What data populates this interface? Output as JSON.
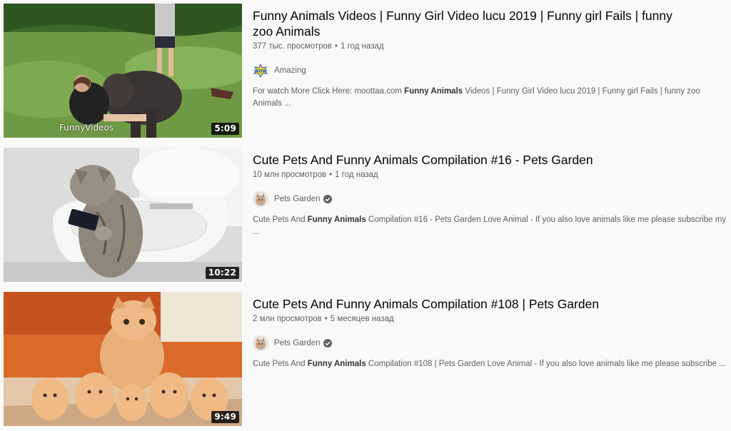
{
  "results": [
    {
      "title": "Funny Animals Videos | Funny Girl Video lucu 2019 | Funny girl Fails | funny zoo Animals",
      "views": "377 тыс. просмотров",
      "age": "1 год назад",
      "channel": "Amazing",
      "verified": false,
      "duration": "5:09",
      "watermark": "FunnyVideos",
      "desc_parts": [
        "For watch More Click Here: moottaa.com ",
        "Funny Animals",
        " Videos | Funny Girl Video lucu 2019 | Funny girl Fails | funny zoo Animals ..."
      ],
      "thumb_icon": "girl-elephant-thumbnail"
    },
    {
      "title": "Cute Pets And Funny Animals Compilation #16 - Pets Garden",
      "views": "10 млн просмотров",
      "age": "1 год назад",
      "channel": "Pets Garden",
      "verified": true,
      "duration": "10:22",
      "desc_parts": [
        "Cute Pets And ",
        "Funny Animals",
        " Compilation #16 - Pets Garden Love Animal - If you also love animals like me please subscribe my ..."
      ],
      "thumb_icon": "cat-on-toilet-thumbnail"
    },
    {
      "title": "Cute Pets And Funny Animals Compilation #108 | Pets Garden",
      "views": "2 млн просмотров",
      "age": "5 месяцев назад",
      "channel": "Pets Garden",
      "verified": true,
      "duration": "9:49",
      "desc_parts": [
        "Cute Pets And ",
        "Funny Animals",
        " Compilation #108 | Pets Garden Love Animal - If you also love animals like me please subscribe ..."
      ],
      "thumb_icon": "cat-and-kittens-thumbnail"
    }
  ],
  "separator": "•",
  "colors": {
    "title": "#030303",
    "secondary": "#606060",
    "background": "#f9f9f9"
  }
}
